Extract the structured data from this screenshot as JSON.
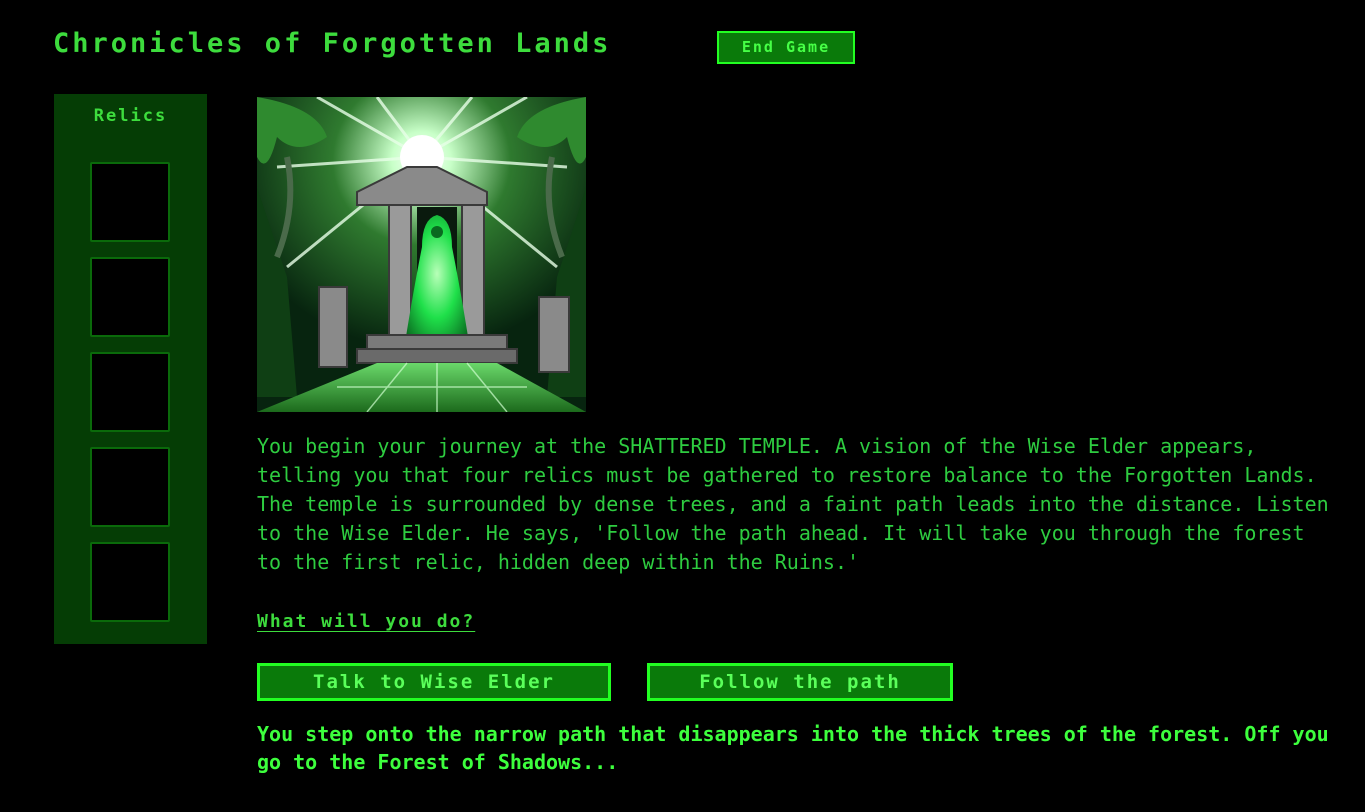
{
  "game": {
    "title": "Chronicles of Forgotten Lands",
    "end_button": "End Game"
  },
  "sidebar": {
    "title": "Relics",
    "slots": [
      "",
      "",
      "",
      "",
      ""
    ]
  },
  "scene": {
    "narration": "You begin your journey at the SHATTERED TEMPLE. A vision of the Wise Elder appears, telling you that four relics must be gathered to restore balance to the Forgotten Lands. The temple is surrounded by dense trees, and a faint path leads into the distance. Listen to the Wise Elder. He says, 'Follow the path ahead. It will take you through the forest to the first relic, hidden deep within the Ruins.'",
    "prompt": "What will you do?",
    "choices": [
      {
        "label": "Talk to Wise Elder"
      },
      {
        "label": "Follow the path"
      }
    ],
    "result": "You step onto the narrow path that disappears into the thick trees of the forest. Off you go to the Forest of Shadows..."
  },
  "colors": {
    "background": "#000000",
    "text": "#2ecc40",
    "accent": "#22ff22",
    "button_fill": "#0a7a0a",
    "sidebar": "#053d05"
  }
}
